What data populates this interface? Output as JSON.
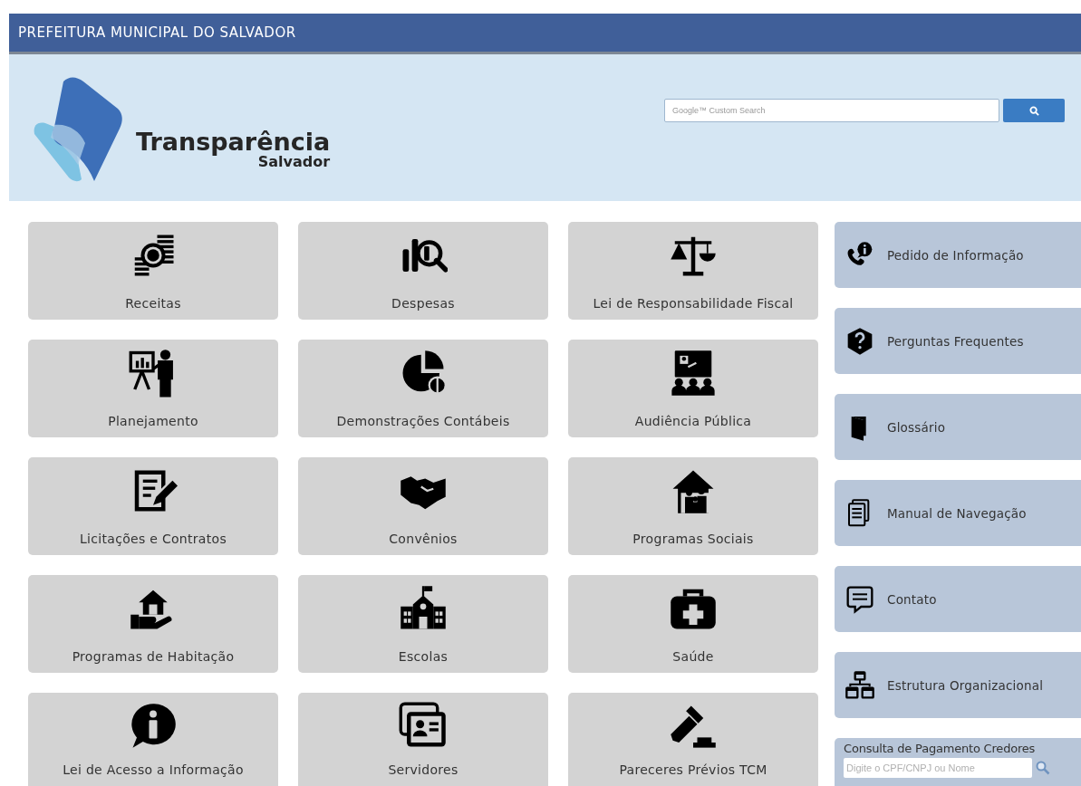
{
  "header": {
    "title": "PREFEITURA MUNICIPAL DO SALVADOR"
  },
  "banner": {
    "logo_title": "Transparência",
    "logo_subtitle": "Salvador",
    "search": {
      "placeholder": "Google™ Custom Search"
    }
  },
  "tiles": [
    {
      "label": "Receitas"
    },
    {
      "label": "Despesas"
    },
    {
      "label": "Lei de Responsabilidade Fiscal"
    },
    {
      "label": "Planejamento"
    },
    {
      "label": "Demonstrações Contábeis"
    },
    {
      "label": "Audiência Pública"
    },
    {
      "label": "Licitações e Contratos"
    },
    {
      "label": "Convênios"
    },
    {
      "label": "Programas Sociais"
    },
    {
      "label": "Programas de Habitação"
    },
    {
      "label": "Escolas"
    },
    {
      "label": "Saúde"
    },
    {
      "label": "Lei de Acesso a Informação"
    },
    {
      "label": "Servidores"
    },
    {
      "label": "Pareceres Prévios TCM"
    }
  ],
  "sidebar": {
    "items": [
      {
        "label": "Pedido de Informação"
      },
      {
        "label": "Perguntas Frequentes"
      },
      {
        "label": "Glossário"
      },
      {
        "label": "Manual de Navegação"
      },
      {
        "label": "Contato"
      },
      {
        "label": "Estrutura Organizacional"
      }
    ],
    "credor_search": {
      "title": "Consulta de Pagamento Credores",
      "placeholder": "Digite o CPF/CNPJ ou Nome"
    }
  }
}
